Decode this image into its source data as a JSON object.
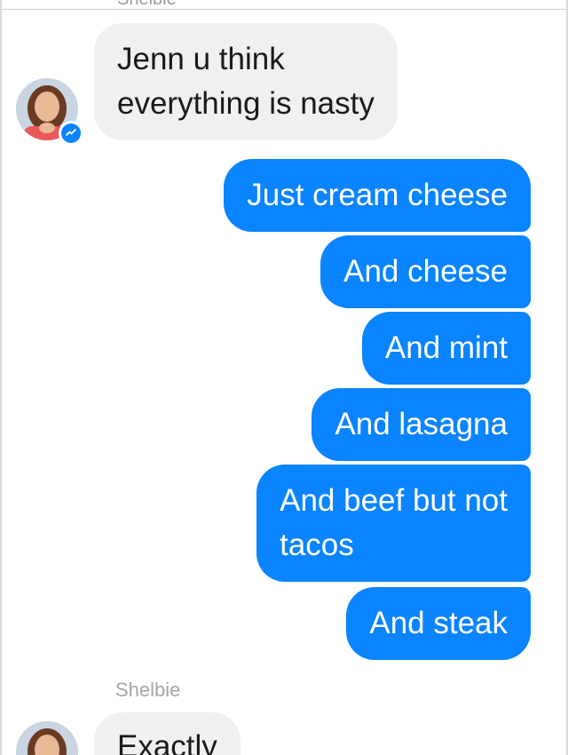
{
  "thread": {
    "top_cut_label": "Shelbie",
    "messages": [
      {
        "direction": "incoming",
        "lines": [
          "Jenn u think",
          "everything is nasty"
        ]
      },
      {
        "direction": "outgoing",
        "text": "Just cream cheese"
      },
      {
        "direction": "outgoing",
        "text": "And cheese"
      },
      {
        "direction": "outgoing",
        "text": "And mint"
      },
      {
        "direction": "outgoing",
        "text": "And lasagna"
      },
      {
        "direction": "outgoing",
        "lines": [
          "And beef but not",
          "tacos"
        ]
      },
      {
        "direction": "outgoing",
        "text": "And steak"
      },
      {
        "direction": "incoming",
        "sender": "Shelbie",
        "text": "Exactly"
      }
    ]
  },
  "colors": {
    "outgoing_bubble": "#0a84ff",
    "incoming_bubble": "#f0f0f0",
    "sender_name": "#a6a6a6"
  },
  "icons": {
    "avatar_badge": "messenger-icon"
  }
}
